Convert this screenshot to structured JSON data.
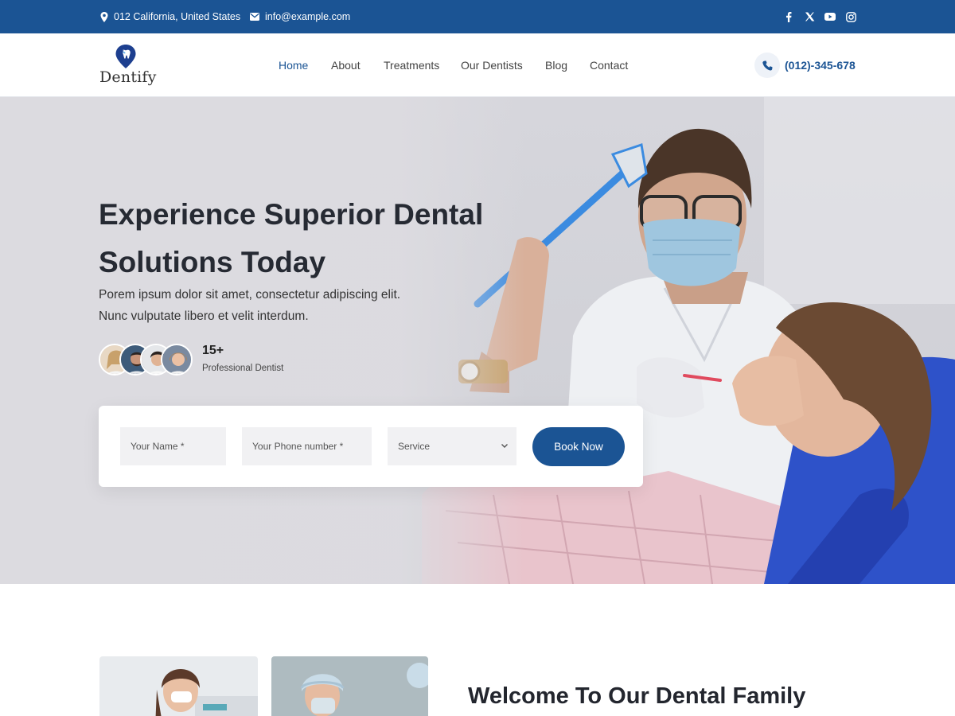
{
  "topbar": {
    "address": "012 California, United States",
    "email": "info@example.com",
    "social_icons": [
      "facebook-icon",
      "x-icon",
      "youtube-icon",
      "instagram-icon"
    ],
    "bg_color": "#1b5494"
  },
  "header": {
    "logo_text": "Dentify",
    "nav": [
      {
        "label": "Home",
        "active": true
      },
      {
        "label": "About"
      },
      {
        "label": "Treatments"
      },
      {
        "label": "Our Dentists"
      },
      {
        "label": "Blog"
      },
      {
        "label": "Contact"
      }
    ],
    "phone": "(012)-345-678"
  },
  "hero": {
    "title_line1": "Experience Superior Dental",
    "title_line2": "Solutions Today",
    "subtitle_line1": "Porem ipsum dolor sit amet, consectetur adipiscing elit.",
    "subtitle_line2": "Nunc vulputate libero et velit interdum.",
    "stat_value": "15+",
    "stat_label": "Professional Dentist",
    "form": {
      "name_placeholder": "Your Name *",
      "phone_placeholder": "Your Phone number *",
      "service_selected": "Service",
      "submit_label": "Book Now"
    }
  },
  "welcome": {
    "heading": "Welcome To Our Dental Family"
  },
  "colors": {
    "accent": "#1b5494",
    "text_dark": "#23262e"
  }
}
